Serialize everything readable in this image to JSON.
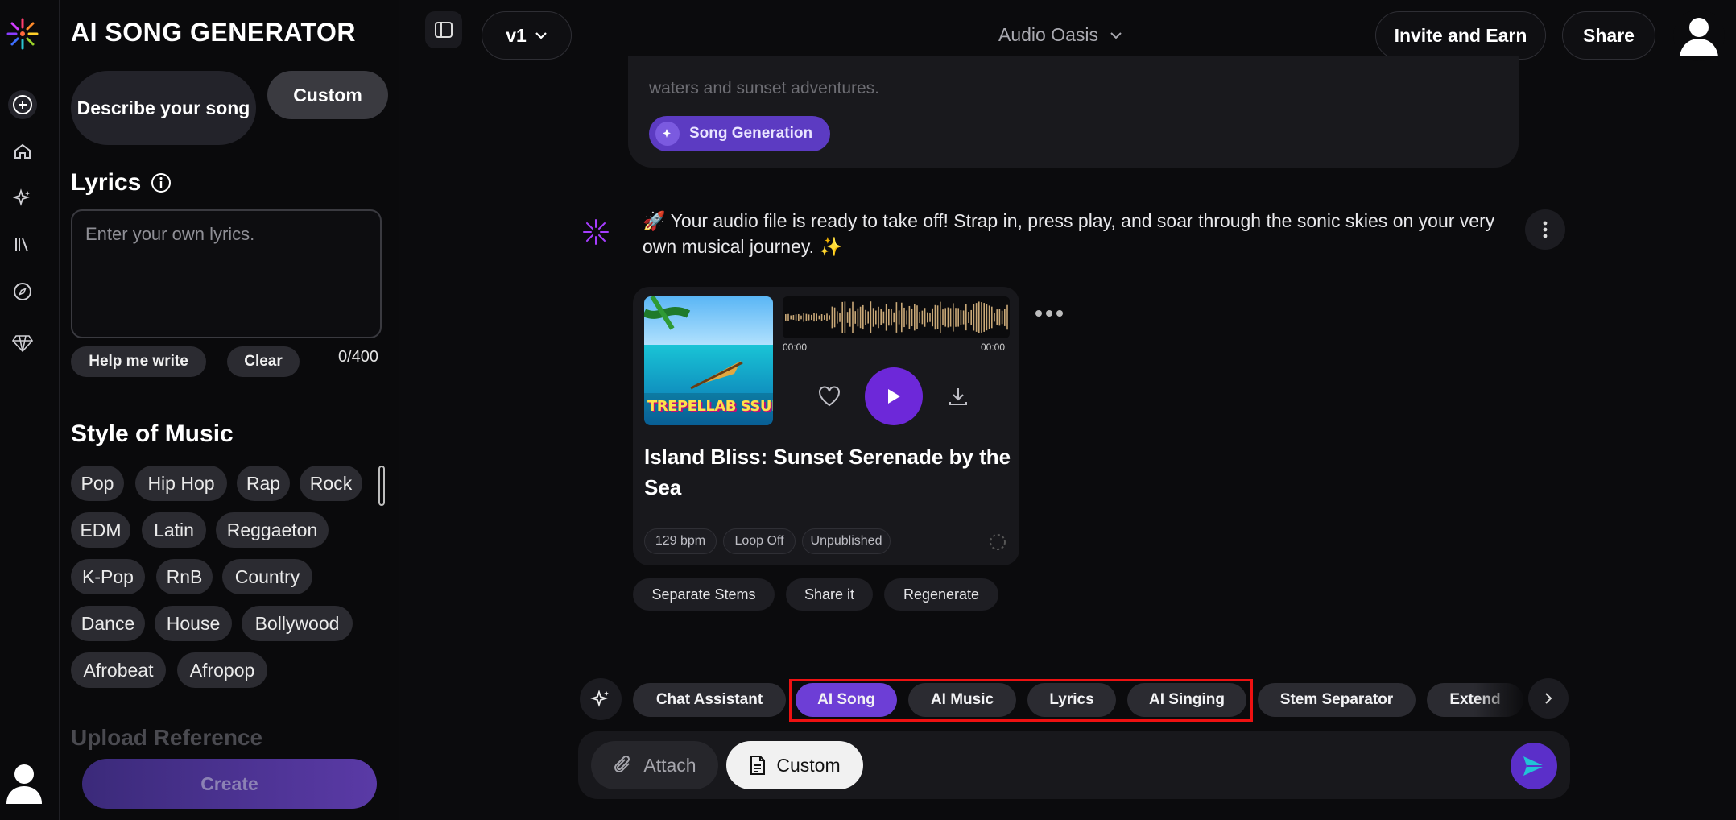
{
  "app": {
    "brand": "AI SONG GENERATOR"
  },
  "sidebar": {
    "tabs": {
      "describe": "Describe your song",
      "custom": "Custom"
    },
    "lyrics": {
      "title": "Lyrics",
      "placeholder": "Enter your own lyrics.",
      "help_label": "Help me write",
      "clear_label": "Clear",
      "counter": "0/400"
    },
    "style": {
      "title": "Style of Music",
      "chips": [
        "Pop",
        "Hip Hop",
        "Rap",
        "Rock",
        "EDM",
        "Latin",
        "Reggaeton",
        "K-Pop",
        "RnB",
        "Country",
        "Dance",
        "House",
        "Bollywood",
        "Afrobeat",
        "Afropop"
      ]
    },
    "next_section_title": "Upload Reference",
    "create_label": "Create"
  },
  "topbar": {
    "version": "v1",
    "title": "Audio Oasis",
    "invite_label": "Invite and Earn",
    "share_label": "Share"
  },
  "chat": {
    "prev_text": "waters and sunset adventures.",
    "prev_chip": "Song Generation",
    "bot_message": "🚀 Your audio file is ready to take off! Strap in, press play, and soar through the sonic skies on your very own musical journey. ✨",
    "song": {
      "cover_text": "TREPELLAB SSUNG",
      "time_start": "00:00",
      "time_end": "00:00",
      "title": "Island Bliss: Sunset Serenade by the Sea",
      "tags": [
        "129 bpm",
        "Loop Off",
        "Unpublished"
      ]
    },
    "actions": [
      "Separate Stems",
      "Share it",
      "Regenerate"
    ]
  },
  "tools": {
    "items": [
      "Chat Assistant",
      "AI Song",
      "AI Music",
      "Lyrics",
      "AI Singing",
      "Stem Separator",
      "Extend"
    ],
    "active": "AI Song"
  },
  "composer": {
    "attach_label": "Attach",
    "custom_label": "Custom"
  },
  "colors": {
    "accent": "#6d3ed6",
    "highlight": "#ee1111"
  }
}
